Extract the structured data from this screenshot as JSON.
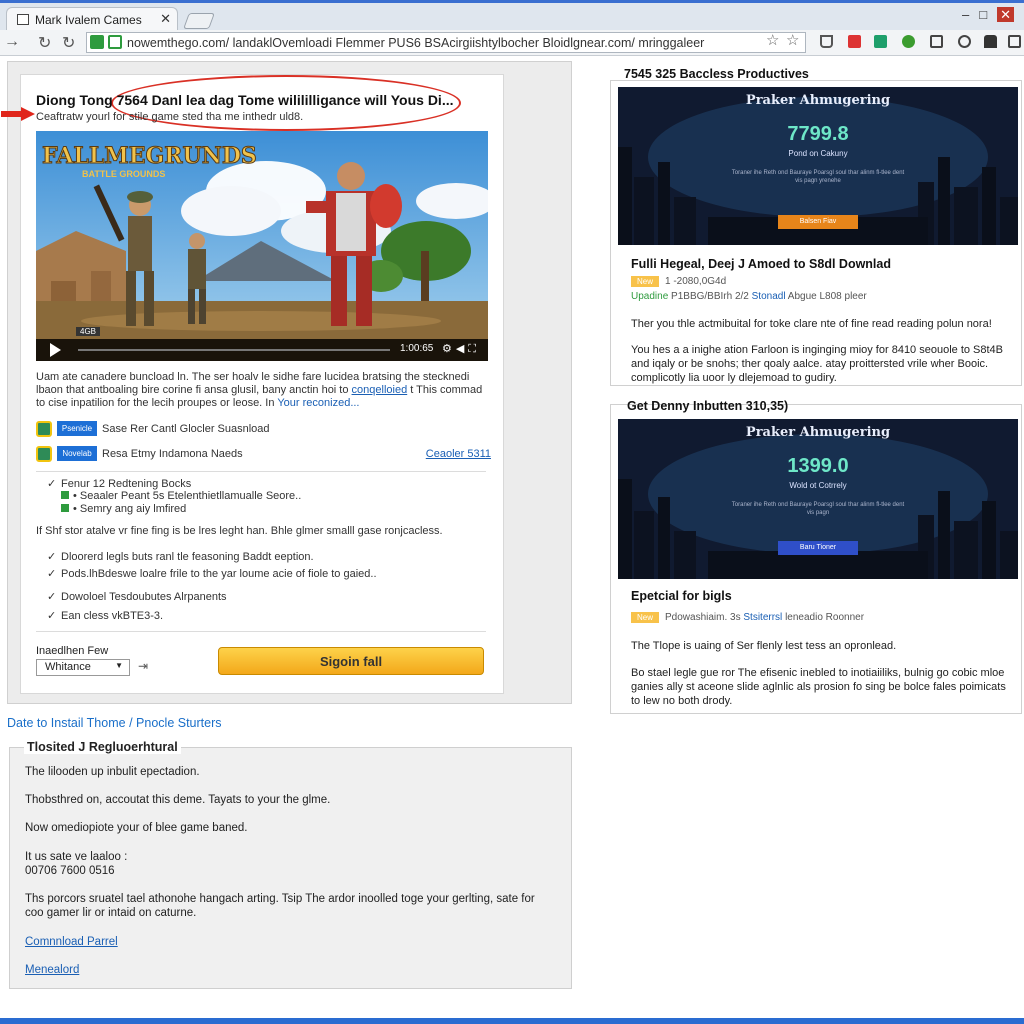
{
  "browser": {
    "tab_title": "Mark Ivalem Cames",
    "url": "nowemthego.com/ landaklOvemloadi Flemmer PUS6 BSAcirgiishtylbocher Bloidlgnear.com/ mringgaleer"
  },
  "main_card": {
    "title": "Diong Tong 7564 Danl lea dag Tome wilililligance will Yous Di...",
    "subtitle": "Ceaftratw yourl for stile game sted tha me inthedr uld8.",
    "video": {
      "overlay_title": "FALLMEGRUNDS",
      "overlay_sub": "BATTLE GROUNDS",
      "time": "1:00:65",
      "mini_label": "4GB"
    },
    "description": {
      "text": "Uam ate canadere buncload ln. The ser hoalv le sidhe fare lucidea bratsing the stecknedi lbaon that antboaling bire corine fi ansa glusil, bany anctin hoi to ",
      "link1": "conqelloied",
      "text2": " t This commad to cise inpatilion for the lecih proupes or leose. In ",
      "link2": "Your reconized..."
    },
    "downloads": [
      {
        "button": "Psenicle",
        "label": "Sase Rer Cantl Glocler Suasnload",
        "right": ""
      },
      {
        "button": "Novelab",
        "label": "Resa Etmy Indamona Naeds",
        "right": "Ceaoler 5311"
      }
    ],
    "features": [
      "Fenur 12 Redtening Bocks",
      "Seaaler Peant 5s Etelenthietllamualle Seore..",
      "Semry ang aiy lmfired"
    ],
    "note": "If Shf stor atalve vr fine fing is be lres leght han. Bhle glmer smalll gase ronjcacless.",
    "checks": [
      "Dloorerd legls buts ranl tle feasoning Baddt eeption.",
      "Pods.lhBdeswe loalre frile to the yar loume acie of fiole to gaied..",
      "Dowoloel Tesdoubutes Alrpanents",
      "Ean cless vkBTE3-3."
    ],
    "quantity_label": "Inaedlhen Few",
    "quantity_value": "Whitance",
    "sign_button": "Sigoin fall"
  },
  "breadcrumb": {
    "item1": "Date to Instail Thome",
    "separator": "/",
    "item2": "Pnocle Sturters"
  },
  "lower_box": {
    "title": "Tlosited J Regluoerhtural",
    "p1": "The lilooden up inbulit epectadion.",
    "p2": "Thobsthred on, accoutat this deme. Tayats to your the glme.",
    "p3": "Now omediopiote your of blee game baned.",
    "p4a": "It us sate ve laaloo :",
    "p4b": "00706 7600 0516",
    "p5": "Ths porcors sruatel tael athonohe hangach arting. Tsip The ardor inoolled toge your gerlting, sate for coo gamer lir or intaid on caturne.",
    "link1": "Comnnload Parrel",
    "link2": "Menealord"
  },
  "right_top": {
    "heading": "7545 325 Baccless Productives",
    "banner_title": "Praker Ahmugering",
    "banner_price": "7799.8",
    "banner_sub": "Pond on Cakuny",
    "banner_fine": "Toraner ihe Reth ond Bauraye Poarsgl soul thar alinm fl-tlee dent vis pagn yrenehe",
    "banner_button": "Balsen Fiav",
    "title": "Fulli Hegeal, Deej J Amoed to S8dl Downlad",
    "badge": "New",
    "meta": "1 -2080,0G4d",
    "meta2_green": "Upadine",
    "meta2": " P1BBG/BBIrh 2/2 ",
    "meta2_blue": "Stonadl",
    "meta2_end": " Abgue L808 pleer",
    "p1": "Ther you thle actmibuital for toke clare nte of fine read reading polun nora!",
    "p2": "You hes a a inighe ation Farloon is inginging mioy for 8410 seouole to S8t4B and iqaly or be snohs; ther qoaly aalce. atay proittersted vrile wher Booic. complicotly lia uoor ly dlejemoad to gudiry."
  },
  "right_bottom": {
    "heading": "Get Denny Inbutten 310,35)",
    "banner_title": "Praker Ahmugering",
    "banner_price": "1399.0",
    "banner_sub": "Wold ot Cotrrely",
    "banner_fine": "Toraner ihe Reth ond Bauraye Poarsgl soul thar alinm fl-tlee dent vis pagn",
    "banner_button": "Baru Tioner",
    "title": "Epetcial for bigls",
    "badge": "New",
    "meta": "Pdowashiaim. 3s ",
    "meta_blue": "Stsiterrsl",
    "meta_end": " leneadio Roonner",
    "p1": "The Tlope is uaing of Ser flenly lest tess an opronlead.",
    "p2": "Bo stael legle gue ror The efisenic inebled to inotiaiiliks, bulnig go cobic mloe ganies ally st aceone slide aglnlic als prosion fo sing be bolce fales poimicats to lew no both drody."
  }
}
